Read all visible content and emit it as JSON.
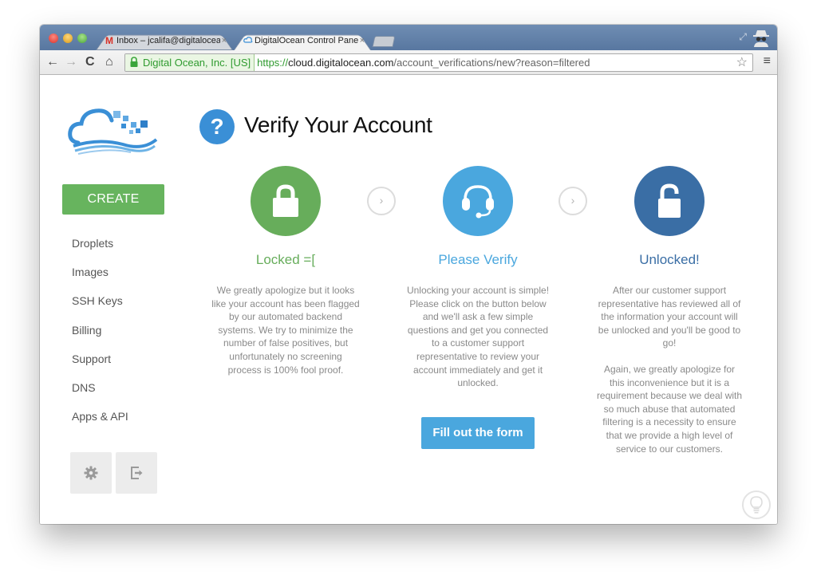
{
  "browser": {
    "tabs": [
      {
        "label": "Inbox – jcalifa@digitalocea",
        "favicon": "gmail-icon",
        "close": "×",
        "active": false
      },
      {
        "label": "DigitalOcean Control Panel",
        "favicon": "cloud-icon",
        "close": "×",
        "active": true
      }
    ],
    "address_bar": {
      "ev_label": "Digital Ocean, Inc. [US]",
      "scheme": "https://",
      "host": "cloud.digitalocean.com",
      "path": "/account_verifications/new?reason=filtered"
    },
    "nav_icons": {
      "back": "←",
      "forward": "→",
      "reload": "C",
      "home": "⌂",
      "star": "☆",
      "menu": "≡",
      "resize": "⤢"
    }
  },
  "sidebar": {
    "create_label": "CREATE",
    "items": [
      {
        "label": "Droplets"
      },
      {
        "label": "Images"
      },
      {
        "label": "SSH Keys"
      },
      {
        "label": "Billing"
      },
      {
        "label": "Support"
      },
      {
        "label": "DNS"
      },
      {
        "label": "Apps & API"
      }
    ]
  },
  "page": {
    "title": "Verify Your Account",
    "title_icon": "?",
    "arrow_glyph": "›",
    "steps": [
      {
        "title": "Locked =[",
        "color": "#67ad5b",
        "icon": "lock-icon",
        "text": "We greatly apologize but it looks like your account has been flagged by our automated backend systems. We try to minimize the number of false positives, but unfortunately no screening process is 100% fool proof."
      },
      {
        "title": "Please Verify",
        "color": "#4aa7de",
        "icon": "headset-icon",
        "text": "Unlocking your account is simple! Please click on the button below and we'll ask a few simple questions and get you connected to a customer support representative to review your account immediately and get it unlocked.",
        "button_label": "Fill out the form"
      },
      {
        "title": "Unlocked!",
        "color": "#3a6ea5",
        "icon": "unlock-icon",
        "text": "After our customer support representative has reviewed all of the information your account will be unlocked and you'll be good to go!",
        "text2": "Again, we greatly apologize for this inconvenience but it is a requirement because we deal with so much abuse that automated filtering is a necessity to ensure that we provide a high level of service to our customers."
      }
    ]
  }
}
